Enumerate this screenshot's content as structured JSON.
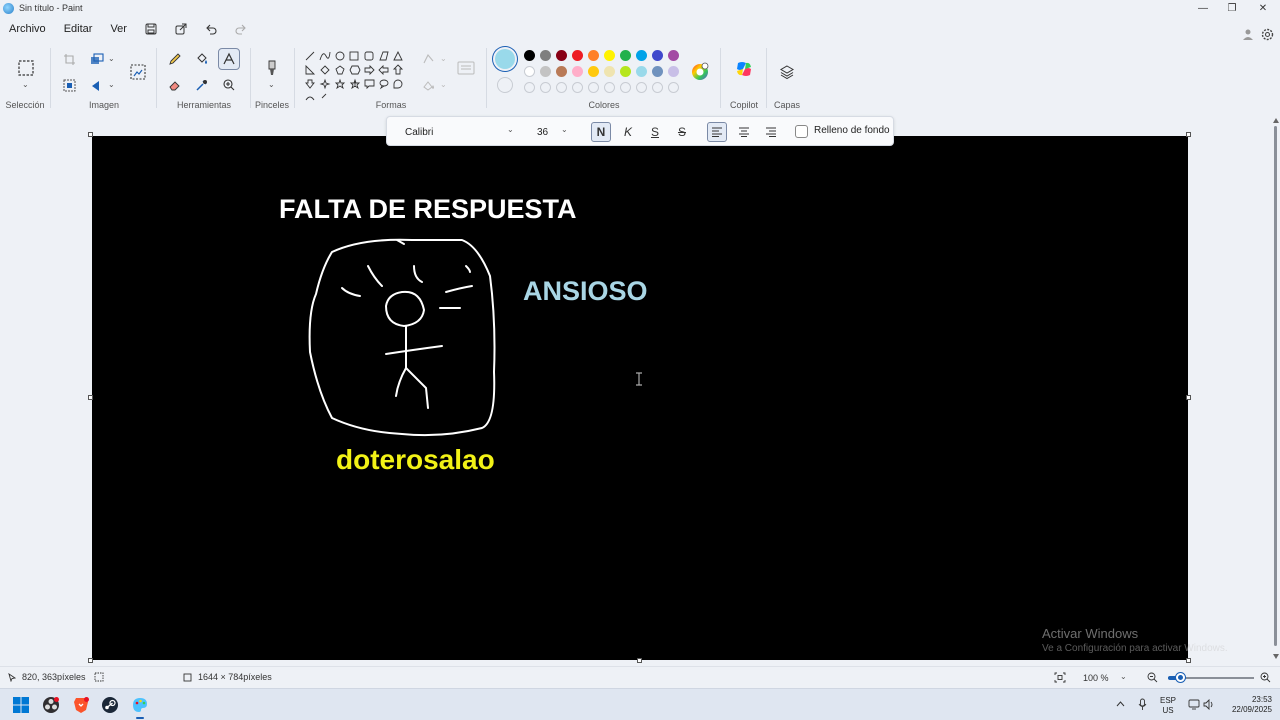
{
  "window": {
    "title": "Sin título - Paint",
    "min": "—",
    "restore": "❐",
    "close": "✕"
  },
  "menu": {
    "file": "Archivo",
    "edit": "Editar",
    "view": "Ver"
  },
  "ribbon": {
    "groups": {
      "selection": "Selección",
      "image": "Imagen",
      "tools": "Herramientas",
      "brushes": "Pinceles",
      "shapes": "Formas",
      "colors": "Colores",
      "copilot": "Copilot",
      "layers": "Capas"
    },
    "colors_row1": [
      "#000000",
      "#7f7f7f",
      "#880015",
      "#ed1c24",
      "#ff7f27",
      "#fff200",
      "#22b14c",
      "#00a2e8",
      "#3f48cc",
      "#a349a4"
    ],
    "colors_row2": [
      "#ffffff",
      "#c3c3c3",
      "#b97a57",
      "#ffaec9",
      "#ffc90e",
      "#efe4b0",
      "#b5e61d",
      "#99d9ea",
      "#7092be",
      "#c8bfe7"
    ],
    "primary_color": "#99d9ea"
  },
  "text_toolbar": {
    "font": "Calibri",
    "size": "36",
    "bold": "N",
    "italic": "K",
    "underline": "S",
    "strike": "S",
    "fill_label": "Relleno de fondo"
  },
  "canvas": {
    "title": "FALTA DE RESPUESTA",
    "ansioso": "ANSIOSO",
    "name": "doterosalao"
  },
  "watermark": {
    "line1": "Activar Windows",
    "line2": "Ve a Configuración para activar Windows."
  },
  "status": {
    "cursor_pos": "820, 363píxeles",
    "canvas_size": "1644 × 784píxeles",
    "zoom": "100 %",
    "zoom_fraction": 0.15
  },
  "taskbar": {
    "lang1": "ESP",
    "lang2": "US",
    "time": "23:53",
    "date": "22/09/2025"
  }
}
